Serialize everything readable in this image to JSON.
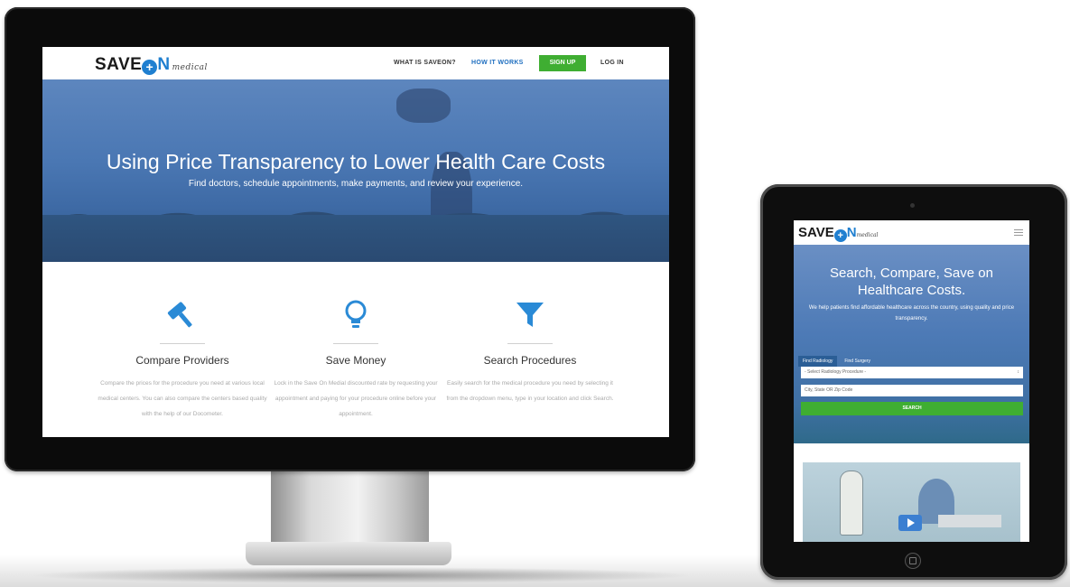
{
  "desktop": {
    "logo": {
      "save": "SAVE",
      "o": "O",
      "n": "N",
      "medical": "medical"
    },
    "nav": {
      "what": "WHAT IS SAVEON?",
      "how": "HOW IT WORKS",
      "signup": "SIGN UP",
      "login": "LOG IN"
    },
    "hero": {
      "title": "Using Price Transparency to Lower Health Care Costs",
      "subtitle": "Find doctors, schedule appointments, make payments, and review your experience."
    },
    "features": [
      {
        "title": "Compare Providers",
        "text": "Compare the prices for the procedure you need at various local medical centers. You can also compare the centers based quality with the help of our Docometer."
      },
      {
        "title": "Save Money",
        "text": "Lock in the Save On Medial discounted rate by requesting your appointment and paying for your procedure online before your appointment."
      },
      {
        "title": "Search Procedures",
        "text": "Easily search for the medical procedure you need by selecting it from the dropdown menu, type in your location and click Search."
      }
    ]
  },
  "tablet": {
    "logo": {
      "save": "SAVE",
      "o": "O",
      "n": "N",
      "medical": "medical"
    },
    "hero": {
      "title_line1": "Search, Compare, Save on",
      "title_line2": "Healthcare Costs.",
      "subtitle": "We help patients find affordable healthcare across the country, using quality and price transparency."
    },
    "tabs": [
      "Find Radiology",
      "Find Surgery"
    ],
    "select_placeholder": "- Select Radiology Procedure -",
    "location_placeholder": "City, State OR Zip Code",
    "search_label": "SEARCH"
  },
  "colors": {
    "brand_blue": "#1f7fd0",
    "signup_green": "#3fae32"
  }
}
